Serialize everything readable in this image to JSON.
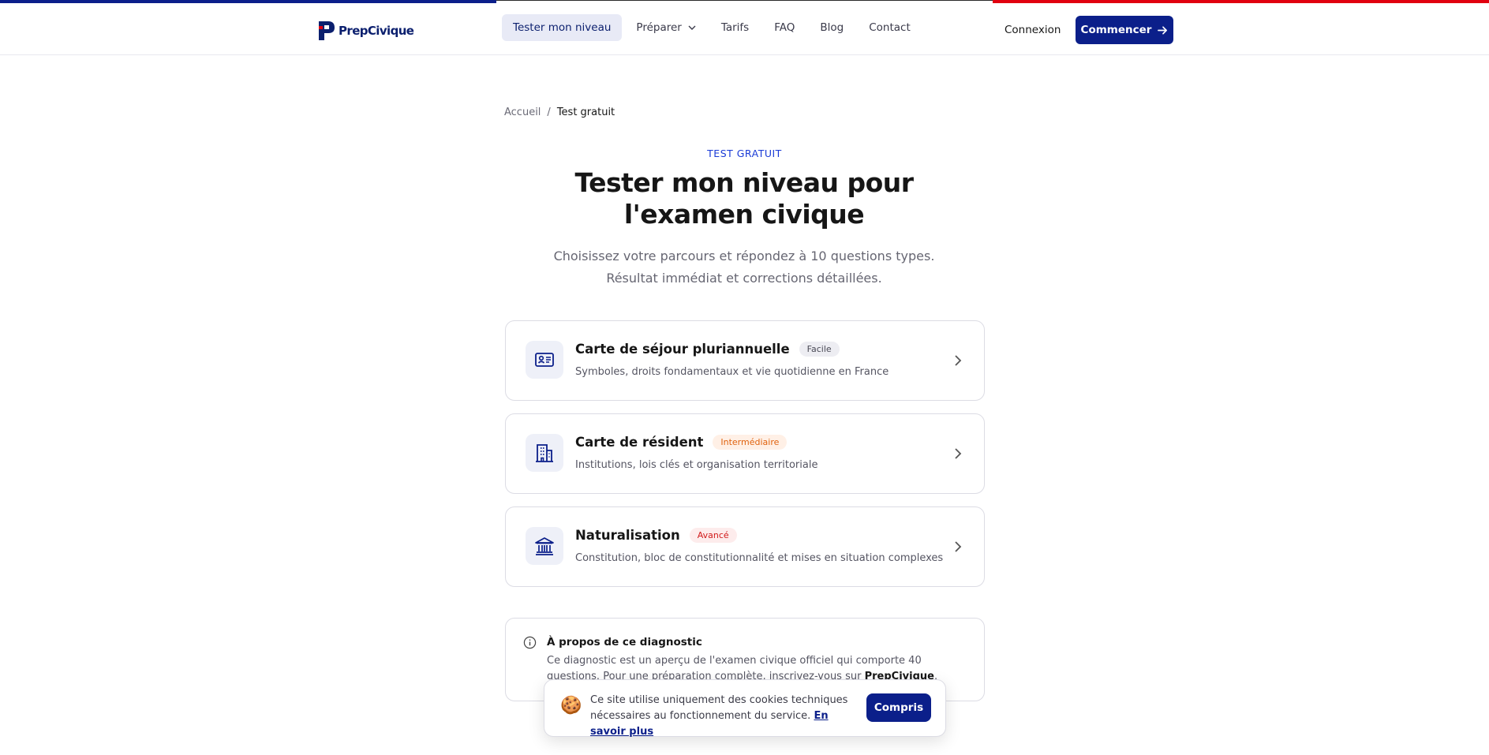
{
  "brand": {
    "name": "PrepCivique",
    "primary": "#0b1f8a",
    "red": "#e1000f"
  },
  "nav": {
    "items": [
      {
        "label": "Tester mon niveau"
      },
      {
        "label": "Préparer"
      },
      {
        "label": "Tarifs"
      },
      {
        "label": "FAQ"
      },
      {
        "label": "Blog"
      },
      {
        "label": "Contact"
      }
    ],
    "login": "Connexion",
    "cta": "Commencer"
  },
  "breadcrumb": {
    "home": "Accueil",
    "separator": "/",
    "current": "Test gratuit"
  },
  "hero": {
    "eyebrow": "TEST GRATUIT",
    "title": "Tester mon niveau pour l'examen civique",
    "subtitle_line1": "Choisissez votre parcours et répondez à 10 questions types.",
    "subtitle_line2": "Résultat immédiat et corrections détaillées."
  },
  "cards": [
    {
      "title": "Carte de séjour pluriannuelle",
      "badge": "Facile",
      "description": "Symboles, droits fondamentaux et vie quotidienne en France",
      "icon": "id-card-icon"
    },
    {
      "title": "Carte de résident",
      "badge": "Intermédiaire",
      "description": "Institutions, lois clés et organisation territoriale",
      "icon": "building-icon"
    },
    {
      "title": "Naturalisation",
      "badge": "Avancé",
      "description": "Constitution, bloc de constitutionnalité et mises en situation complexes",
      "icon": "institution-icon"
    }
  ],
  "info": {
    "title": "À propos de ce diagnostic",
    "text": "Ce diagnostic est un aperçu de l'examen civique officiel qui comporte 40 questions. Pour une préparation complète, inscrivez-vous sur",
    "brand": "PrepCivique",
    "end": "."
  },
  "cookie": {
    "text": "Ce site utilise uniquement des cookies techniques nécessaires au fonctionnement du service.",
    "link": "En savoir plus",
    "button": "Compris"
  }
}
